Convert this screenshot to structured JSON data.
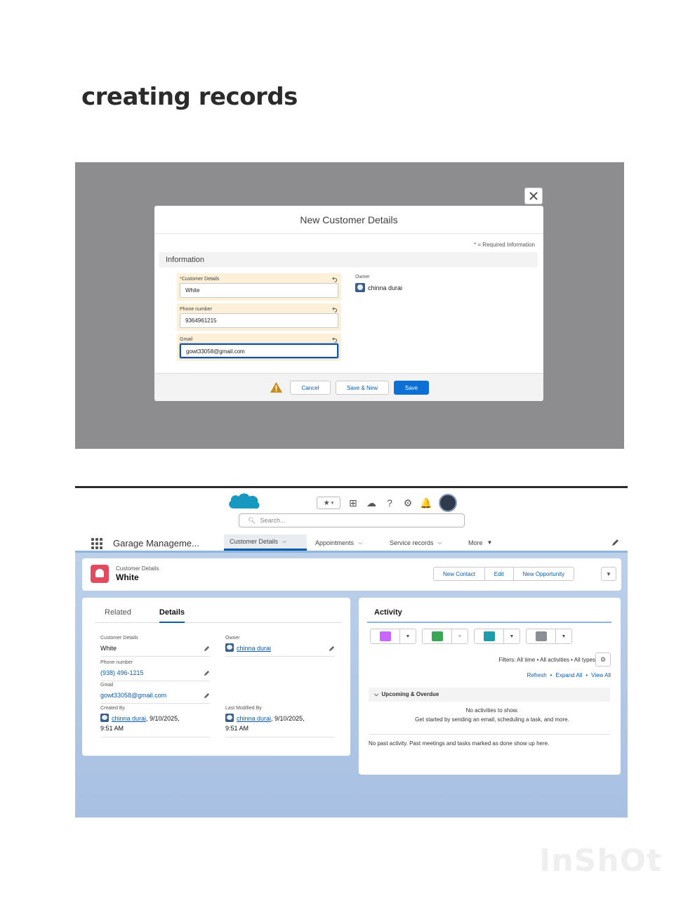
{
  "heading": "creating records",
  "modal": {
    "title": "New Customer Details",
    "required_info": "= Required Information",
    "required_star": "*",
    "section": "Information",
    "fields": [
      {
        "label": "Customer Details",
        "required": "*",
        "value": "White"
      },
      {
        "label": "Phone number",
        "value": "9364961215"
      },
      {
        "label": "Gmail",
        "value": "gowt33058@gmail.com"
      }
    ],
    "owner_label": "Owner",
    "owner_value": "chinna durai",
    "buttons": {
      "cancel": "Cancel",
      "save_new": "Save & New",
      "save": "Save"
    }
  },
  "app": {
    "search_placeholder": "Search...",
    "app_name": "Garage Manageme...",
    "nav_tabs": [
      "Customer Details",
      "Appointments",
      "Service records",
      "More"
    ],
    "record_type": "Customer Details",
    "record_name": "White",
    "header_buttons": [
      "New Contact",
      "Edit",
      "New Opportunity"
    ],
    "tabs": [
      "Related",
      "Details"
    ],
    "details": {
      "customer_details_label": "Customer Details",
      "customer_details_value": "White",
      "owner_label": "Owner",
      "owner_value": "chinna durai",
      "phone_label": "Phone number",
      "phone_value": "(938) 496-1215",
      "gmail_label": "Gmail",
      "gmail_value": "gowt33058@gmail.com",
      "created_label": "Created By",
      "created_by": "chinna durai",
      "created_date": ", 9/10/2025,",
      "created_time": "9:51 AM",
      "modified_label": "Last Modified By",
      "modified_by": "chinna durai",
      "modified_date": ", 9/10/2025,",
      "modified_time": "9:51 AM"
    },
    "activity": {
      "title": "Activity",
      "filters": "Filters: All time • All activities • All types",
      "links": [
        "Refresh",
        "•",
        "Expand All",
        "•",
        "View All"
      ],
      "upcoming": "Upcoming & Overdue",
      "no_activities": "No activities to show.",
      "get_started": "Get started by sending an email, scheduling a task, and more.",
      "no_past": "No past activity. Past meetings and tasks marked as done show up here."
    }
  },
  "watermark": "InShOt",
  "colors": {
    "brand": "#0b6fd6",
    "record_icon": "#e3495f",
    "modal_overlay": "#8d8d90"
  }
}
